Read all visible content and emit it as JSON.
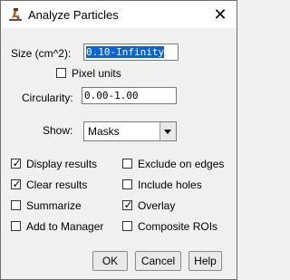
{
  "window": {
    "title": "Analyze Particles"
  },
  "fields": {
    "size": {
      "label": "Size (cm^2):",
      "value": "0.10-Infinity"
    },
    "circularity": {
      "label": "Circularity:",
      "value": "0.00-1.00"
    }
  },
  "pixel_units": {
    "label": "Pixel units",
    "checked": false
  },
  "show": {
    "label": "Show:",
    "selected": "Masks"
  },
  "options": [
    {
      "label": "Display results",
      "checked": true
    },
    {
      "label": "Exclude on edges",
      "checked": false
    },
    {
      "label": "Clear results",
      "checked": true
    },
    {
      "label": "Include holes",
      "checked": false
    },
    {
      "label": "Summarize",
      "checked": false
    },
    {
      "label": "Overlay",
      "checked": true
    },
    {
      "label": "Add to Manager",
      "checked": false
    },
    {
      "label": "Composite ROIs",
      "checked": false
    }
  ],
  "buttons": {
    "ok": "OK",
    "cancel": "Cancel",
    "help": "Help"
  },
  "icons": {
    "close": "close-icon",
    "app": "microscope-icon",
    "dropdown": "chevron-down-icon"
  }
}
